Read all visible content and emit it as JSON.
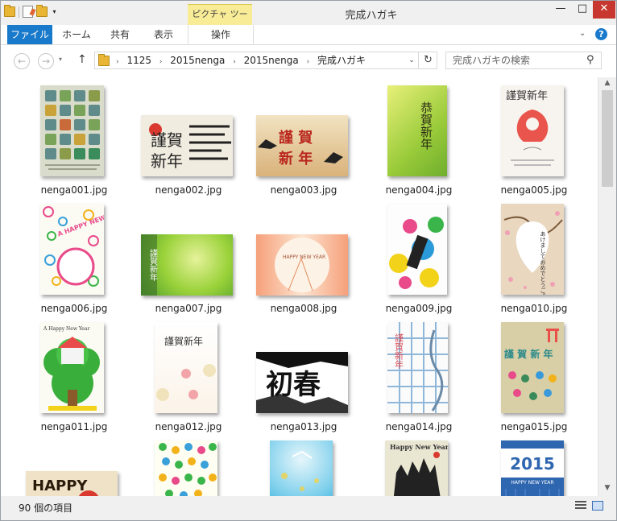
{
  "window": {
    "title": "完成ハガキ",
    "context_tab_group": "ピクチャ ツール",
    "controls": {
      "minimize": "—",
      "maximize": "□",
      "close": "✕"
    }
  },
  "ribbon": {
    "file": "ファイル",
    "home": "ホーム",
    "share": "共有",
    "view": "表示",
    "manage": "操作",
    "toggle": "⌄",
    "help": "?"
  },
  "nav": {
    "back": "←",
    "forward": "→",
    "recent": "▾",
    "up": "↑",
    "breadcrumb": [
      "1125",
      "2015nenga",
      "2015nenga",
      "完成ハガキ"
    ],
    "chevron": "›",
    "refresh": "↻",
    "addr_dropdown": "⌄"
  },
  "search": {
    "placeholder": "完成ハガキの検索",
    "icon": "🔍"
  },
  "files": [
    {
      "name": "nenga001.jpg"
    },
    {
      "name": "nenga002.jpg"
    },
    {
      "name": "nenga003.jpg"
    },
    {
      "name": "nenga004.jpg"
    },
    {
      "name": "nenga005.jpg"
    },
    {
      "name": "nenga006.jpg"
    },
    {
      "name": "nenga007.jpg"
    },
    {
      "name": "nenga008.jpg"
    },
    {
      "name": "nenga009.jpg"
    },
    {
      "name": "nenga010.jpg"
    },
    {
      "name": "nenga011.jpg"
    },
    {
      "name": "nenga012.jpg"
    },
    {
      "name": "nenga013.jpg"
    },
    {
      "name": "nenga014.jpg"
    },
    {
      "name": "nenga015.jpg"
    },
    {
      "name": ""
    },
    {
      "name": ""
    },
    {
      "name": ""
    },
    {
      "name": ""
    },
    {
      "name": ""
    }
  ],
  "thumb_text": {
    "t002": "謹賀\n新年",
    "t003": "謹 賀\n新 年",
    "t004": "恭賀新年",
    "t005": "謹賀新年",
    "t006": "A HAPPY NEW YEAR",
    "t007": "謹賀新年",
    "t008": "HAPPY NEW YEAR",
    "t010": "あけましておめでとうございます",
    "t011": "A Happy New Year",
    "t012": "謹賀新年",
    "t013": "初春",
    "t014": "謹賀新年",
    "t015": "謹 賀 新 年",
    "t016": "HAPPY",
    "t019": "Happy New Year",
    "t020": "2015",
    "t020b": "HAPPY NEW YEAR"
  },
  "status": {
    "count": "90 個の項目"
  },
  "colors": {
    "accent": "#1979ca",
    "context_tab": "#f8ec96",
    "close": "#c7372f"
  }
}
